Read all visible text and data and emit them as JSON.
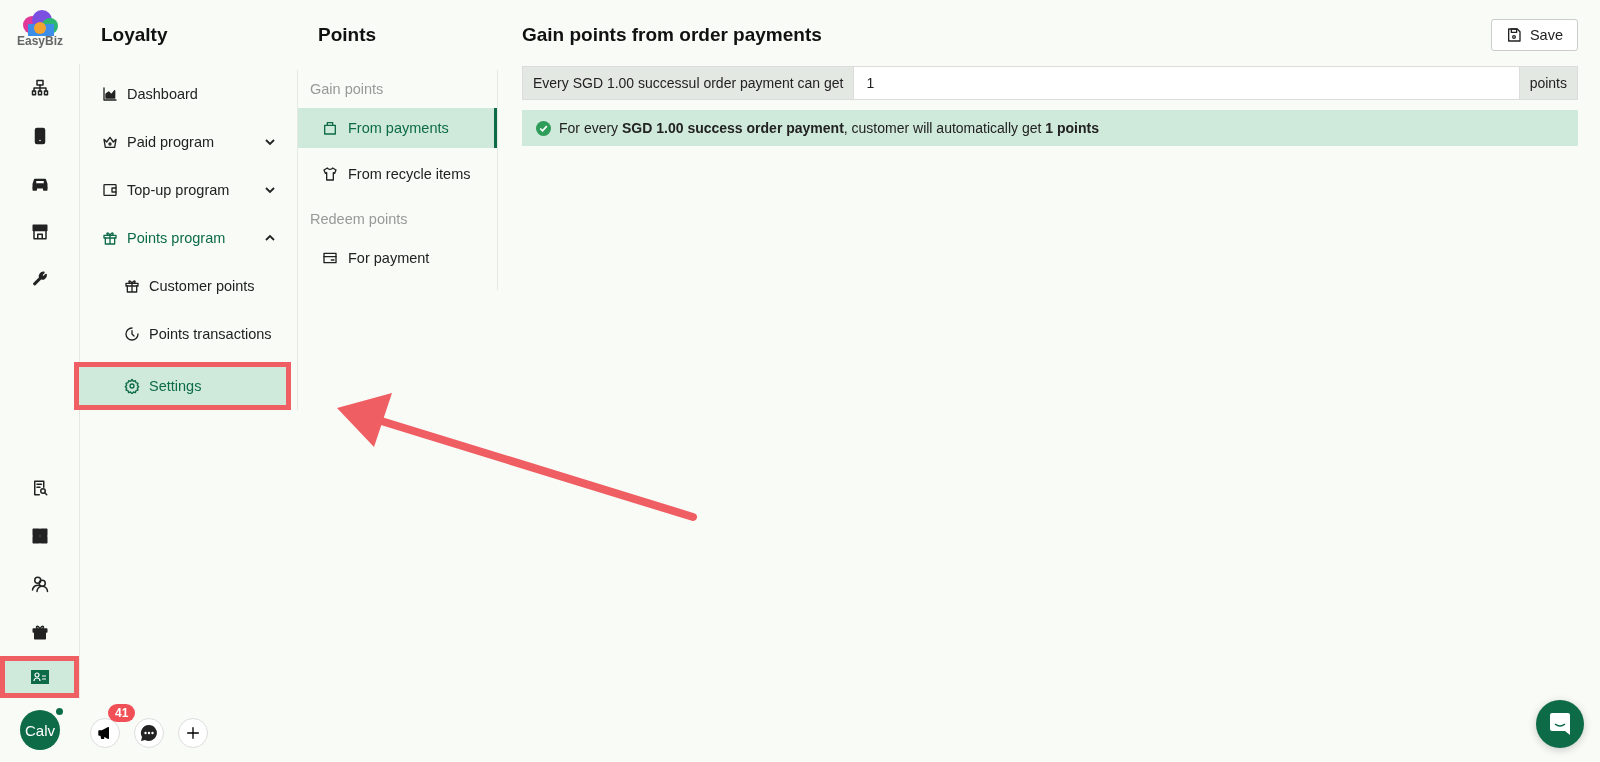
{
  "logo": {
    "text": "EasyBiz"
  },
  "rail": {
    "top": [
      {
        "selected": false
      },
      {
        "selected": false
      },
      {
        "selected": false
      },
      {
        "selected": false
      },
      {
        "selected": false
      }
    ],
    "bottom": [
      {
        "selected": false,
        "highlighted": false
      },
      {
        "selected": false,
        "highlighted": false
      },
      {
        "selected": false,
        "highlighted": false
      },
      {
        "selected": false,
        "highlighted": false
      },
      {
        "selected": true,
        "highlighted": true
      }
    ]
  },
  "user": {
    "initials": "Calv",
    "online": true
  },
  "actions": [
    {
      "kind": "announce",
      "badge": "41"
    },
    {
      "kind": "chat"
    },
    {
      "kind": "add"
    }
  ],
  "menu": {
    "title": "Loyalty",
    "items": [
      {
        "kind": "link",
        "label": "Dashboard",
        "selected": false
      },
      {
        "kind": "group",
        "label": "Paid program",
        "selected": false,
        "expanded": false
      },
      {
        "kind": "group",
        "label": "Top-up program",
        "selected": false,
        "expanded": false
      },
      {
        "kind": "group",
        "label": "Points program",
        "selected": true,
        "expanded": true,
        "children": [
          {
            "label": "Customer points",
            "selected": false,
            "highlighted": false
          },
          {
            "label": "Points transactions",
            "selected": false,
            "highlighted": false
          },
          {
            "label": "Settings",
            "selected": true,
            "highlighted": true
          }
        ]
      }
    ]
  },
  "points_menu": {
    "title": "Points",
    "sections": [
      {
        "heading": "Gain points",
        "items": [
          {
            "label": "From payments",
            "selected": true
          },
          {
            "label": "From recycle items",
            "selected": false
          }
        ]
      },
      {
        "heading": "Redeem points",
        "items": [
          {
            "label": "For payment",
            "selected": false
          }
        ]
      }
    ]
  },
  "main": {
    "title": "Gain points from order payments",
    "save_button": "Save",
    "rate": {
      "prefix": "Every SGD 1.00 successul order payment can get",
      "value": "1",
      "suffix": "points"
    },
    "alert": {
      "text": "For every **SGD 1.00 success order payment**, customer will automatically get **1 points**"
    }
  },
  "annotations": [
    {
      "kind": "arrow"
    }
  ]
}
